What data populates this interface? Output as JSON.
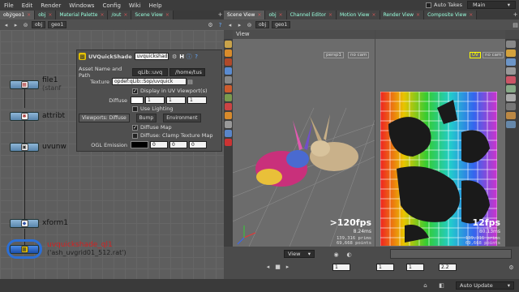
{
  "menubar": {
    "items": [
      "File",
      "Edit",
      "Render",
      "Windows",
      "Config",
      "Wiki",
      "Help"
    ],
    "auto_takes": "Auto Takes",
    "desktop": "Main"
  },
  "left_tabs": [
    {
      "label": "obj/geo1",
      "active": true
    },
    {
      "label": "obj",
      "active": false
    },
    {
      "label": "Material Palette",
      "active": false
    },
    {
      "label": "/out",
      "active": false
    },
    {
      "label": "Scene View",
      "active": false
    }
  ],
  "right_tabs": [
    {
      "label": "Scene View",
      "active": true
    },
    {
      "label": "obj",
      "active": false
    },
    {
      "label": "Channel Editor",
      "active": false
    },
    {
      "label": "Motion View",
      "active": false
    },
    {
      "label": "Render View",
      "active": false
    },
    {
      "label": "Composite View",
      "active": false
    }
  ],
  "left_path": {
    "obj": "obj",
    "geo": "geo1"
  },
  "right_path": {
    "obj": "obj",
    "geo": "geo1"
  },
  "network": {
    "nodes": [
      {
        "label": "file1",
        "sub": "(stanf",
        "icon": "file-icon"
      },
      {
        "label": "attribt",
        "sub": "",
        "icon": "attribute-icon"
      },
      {
        "label": "uvunw",
        "sub": "",
        "icon": "uvunwrap-icon"
      },
      {
        "label": "xform1",
        "sub": "",
        "icon": "transform-icon"
      },
      {
        "label": "uvquickshade_ql1",
        "sub": "('ash_uvgrid01_512.rat')",
        "icon": "uvquickshade-icon"
      }
    ]
  },
  "params": {
    "node_type": "UVQuickShade",
    "node_name": "uvquickshad",
    "asset_name_label": "Asset Name and Path",
    "asset_name": "qLib::uvq",
    "asset_path": "/home/tus",
    "texture_label": "Texture",
    "texture_value": "opdef:qLib::Sop/uvquick",
    "display_uv_label": "Display in UV Viewport(s)",
    "diffuse_label": "Diffuse",
    "diffuse_values": [
      "1",
      "1",
      "1"
    ],
    "use_lighting_label": "Use Lighting",
    "tabs": [
      "Viewports: Diffuse",
      "Bump",
      "Environment"
    ],
    "diffuse_map_label": "Diffuse Map",
    "clamp_label": "Diffuse: Clamp Texture Map",
    "ogl_emission_label": "OGL Emission",
    "ogl_emission_values": [
      "0",
      "0",
      "0"
    ]
  },
  "viewport1": {
    "title": "View",
    "persp": "persp1",
    "cam": "no cam",
    "fps": ">120fps",
    "ms": "8.24ms",
    "stats": [
      "139,316  prims",
      "69,668  points"
    ]
  },
  "viewport2": {
    "uv": "UV",
    "cam": "no cam",
    "fps": "12fps",
    "ms": "80.13ms",
    "stats": [
      "139,316  prims",
      "69,668  points"
    ]
  },
  "timeline": {
    "view_label": "View",
    "frame": "1",
    "start": "1",
    "scale": "1",
    "end_field": "2.2"
  },
  "statusbar": {
    "auto_update": "Auto Update"
  },
  "colors": {
    "node_blue": "#6b9bc7",
    "selected_node": "#2b6fd6",
    "selected_label": "#d22222"
  }
}
